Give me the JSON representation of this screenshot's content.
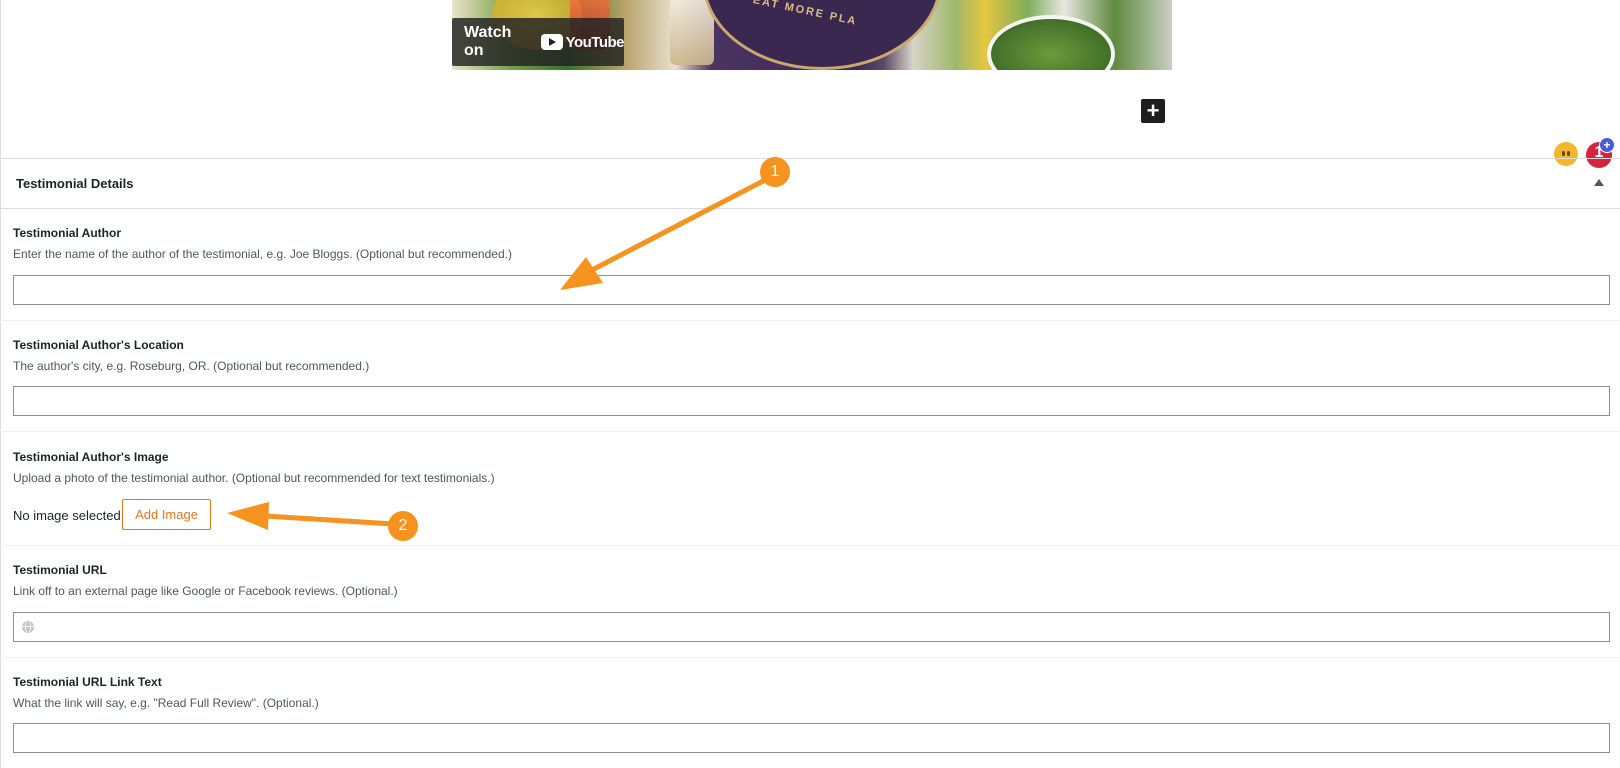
{
  "video": {
    "watch_label": "Watch on",
    "youtube_word": "YouTube",
    "stamp_text": "EAT MORE PLA"
  },
  "editor": {
    "inserter_symbol": "+"
  },
  "notifications": {
    "count": "1",
    "plus_symbol": "+"
  },
  "metabox": {
    "title": "Testimonial Details",
    "fields": {
      "author": {
        "label": "Testimonial Author",
        "description": "Enter the name of the author of the testimonial, e.g. Joe Bloggs. (Optional but recommended.)",
        "value": ""
      },
      "location": {
        "label": "Testimonial Author's Location",
        "description": "The author's city, e.g. Roseburg, OR. (Optional but recommended.)",
        "value": ""
      },
      "image": {
        "label": "Testimonial Author's Image",
        "description": "Upload a photo of the testimonial author. (Optional but recommended for text testimonials.)",
        "status": "No image selected",
        "button_label": "Add Image"
      },
      "url": {
        "label": "Testimonial URL",
        "description": "Link off to an external page like Google or Facebook reviews. (Optional.)",
        "value": ""
      },
      "link_text": {
        "label": "Testimonial URL Link Text",
        "description": "What the link will say, e.g. \"Read Full Review\". (Optional.)",
        "value": ""
      }
    }
  },
  "annotations": {
    "callout_1": "1",
    "callout_2": "2",
    "color": "#f6921e"
  },
  "colors": {
    "accent": "#e7761b",
    "badge": "#d6243c"
  }
}
